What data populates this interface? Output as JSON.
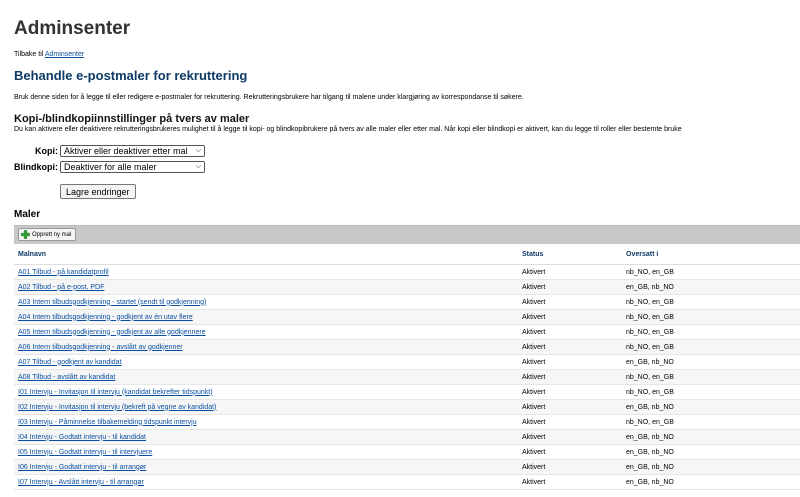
{
  "header": {
    "title": "Adminsenter",
    "back_prefix": "Tilbake til",
    "back_link": "Adminsenter"
  },
  "page": {
    "subtitle": "Behandle e-postmaler for rekruttering",
    "description": "Bruk denne siden for å legge til eller redigere e-postmaler for rekruttering. Rekrutteringsbrukere har tilgang til malene under klargjøring av korrespondanse til søkere."
  },
  "settings": {
    "title": "Kopi-/blindkopiinnstillinger på tvers av maler",
    "description": "Du kan aktivere eller deaktivere rekrutteringsbrukeres mulighet til å legge til kopi- og blindkopibrukere på tvers av alle maler eller etter mal. Når kopi eller blindkopi er aktivert, kan du legge til roller eller bestemte bruke",
    "cc_label": "Kopi:",
    "cc_value": "Aktiver eller deaktiver etter mal",
    "bcc_label": "Blindkopi:",
    "bcc_value": "Deaktiver for alle maler",
    "save_label": "Lagre endringer"
  },
  "templates": {
    "title": "Maler",
    "create_label": "Opprett ny mal",
    "columns": [
      "Malnavn",
      "Status",
      "Oversatt i"
    ],
    "rows": [
      {
        "name": "A01 Tilbud - på kandidatprofil",
        "status": "Aktivert",
        "translated": "nb_NO, en_GB"
      },
      {
        "name": "A02 Tilbud - på e-post, PDF",
        "status": "Aktivert",
        "translated": "en_GB, nb_NO"
      },
      {
        "name": "A03 Intern tilbudsgodkjenning - startet (sendt til godkjenning)",
        "status": "Aktivert",
        "translated": "nb_NO, en_GB"
      },
      {
        "name": "A04 Intern tilbudsgodkjenning - godkjent av én utav flere",
        "status": "Aktivert",
        "translated": "nb_NO, en_GB"
      },
      {
        "name": "A05 Intern tilbudsgodkjenning - godkjent av alle godkjennere",
        "status": "Aktivert",
        "translated": "nb_NO, en_GB"
      },
      {
        "name": "A06 Intern tilbudsgodkjenning - avslått av godkjenner",
        "status": "Aktivert",
        "translated": "nb_NO, en_GB"
      },
      {
        "name": "A07 Tilbud - godkjent av kandidat",
        "status": "Aktivert",
        "translated": "en_GB, nb_NO"
      },
      {
        "name": "A08 Tilbud - avslått av kandidat",
        "status": "Aktivert",
        "translated": "nb_NO, en_GB"
      },
      {
        "name": "I01 Intervju - Invitasjon til intervju (kandidat bekrefter tidspunkt)",
        "status": "Aktivert",
        "translated": "nb_NO, en_GB"
      },
      {
        "name": "I02 Intervju - Invitasjon til intervju (bekreft på vegne av kandidat)",
        "status": "Aktivert",
        "translated": "en_GB, nb_NO"
      },
      {
        "name": "I03 Intervju - Påminnelse tilbakemelding tidspunkt intervju",
        "status": "Aktivert",
        "translated": "nb_NO, en_GB"
      },
      {
        "name": "I04 Intervju - Godtatt intervju - til kandidat",
        "status": "Aktivert",
        "translated": "en_GB, nb_NO"
      },
      {
        "name": "I05 Intervju - Godtatt intervju - til intervjuere",
        "status": "Aktivert",
        "translated": "en_GB, nb_NO"
      },
      {
        "name": "I06 Intervju - Godtatt intervju - til arrangør",
        "status": "Aktivert",
        "translated": "en_GB, nb_NO"
      },
      {
        "name": "I07 Intervju - Avslått intervju - til arrangør",
        "status": "Aktivert",
        "translated": "en_GB, nb_NO"
      }
    ]
  }
}
